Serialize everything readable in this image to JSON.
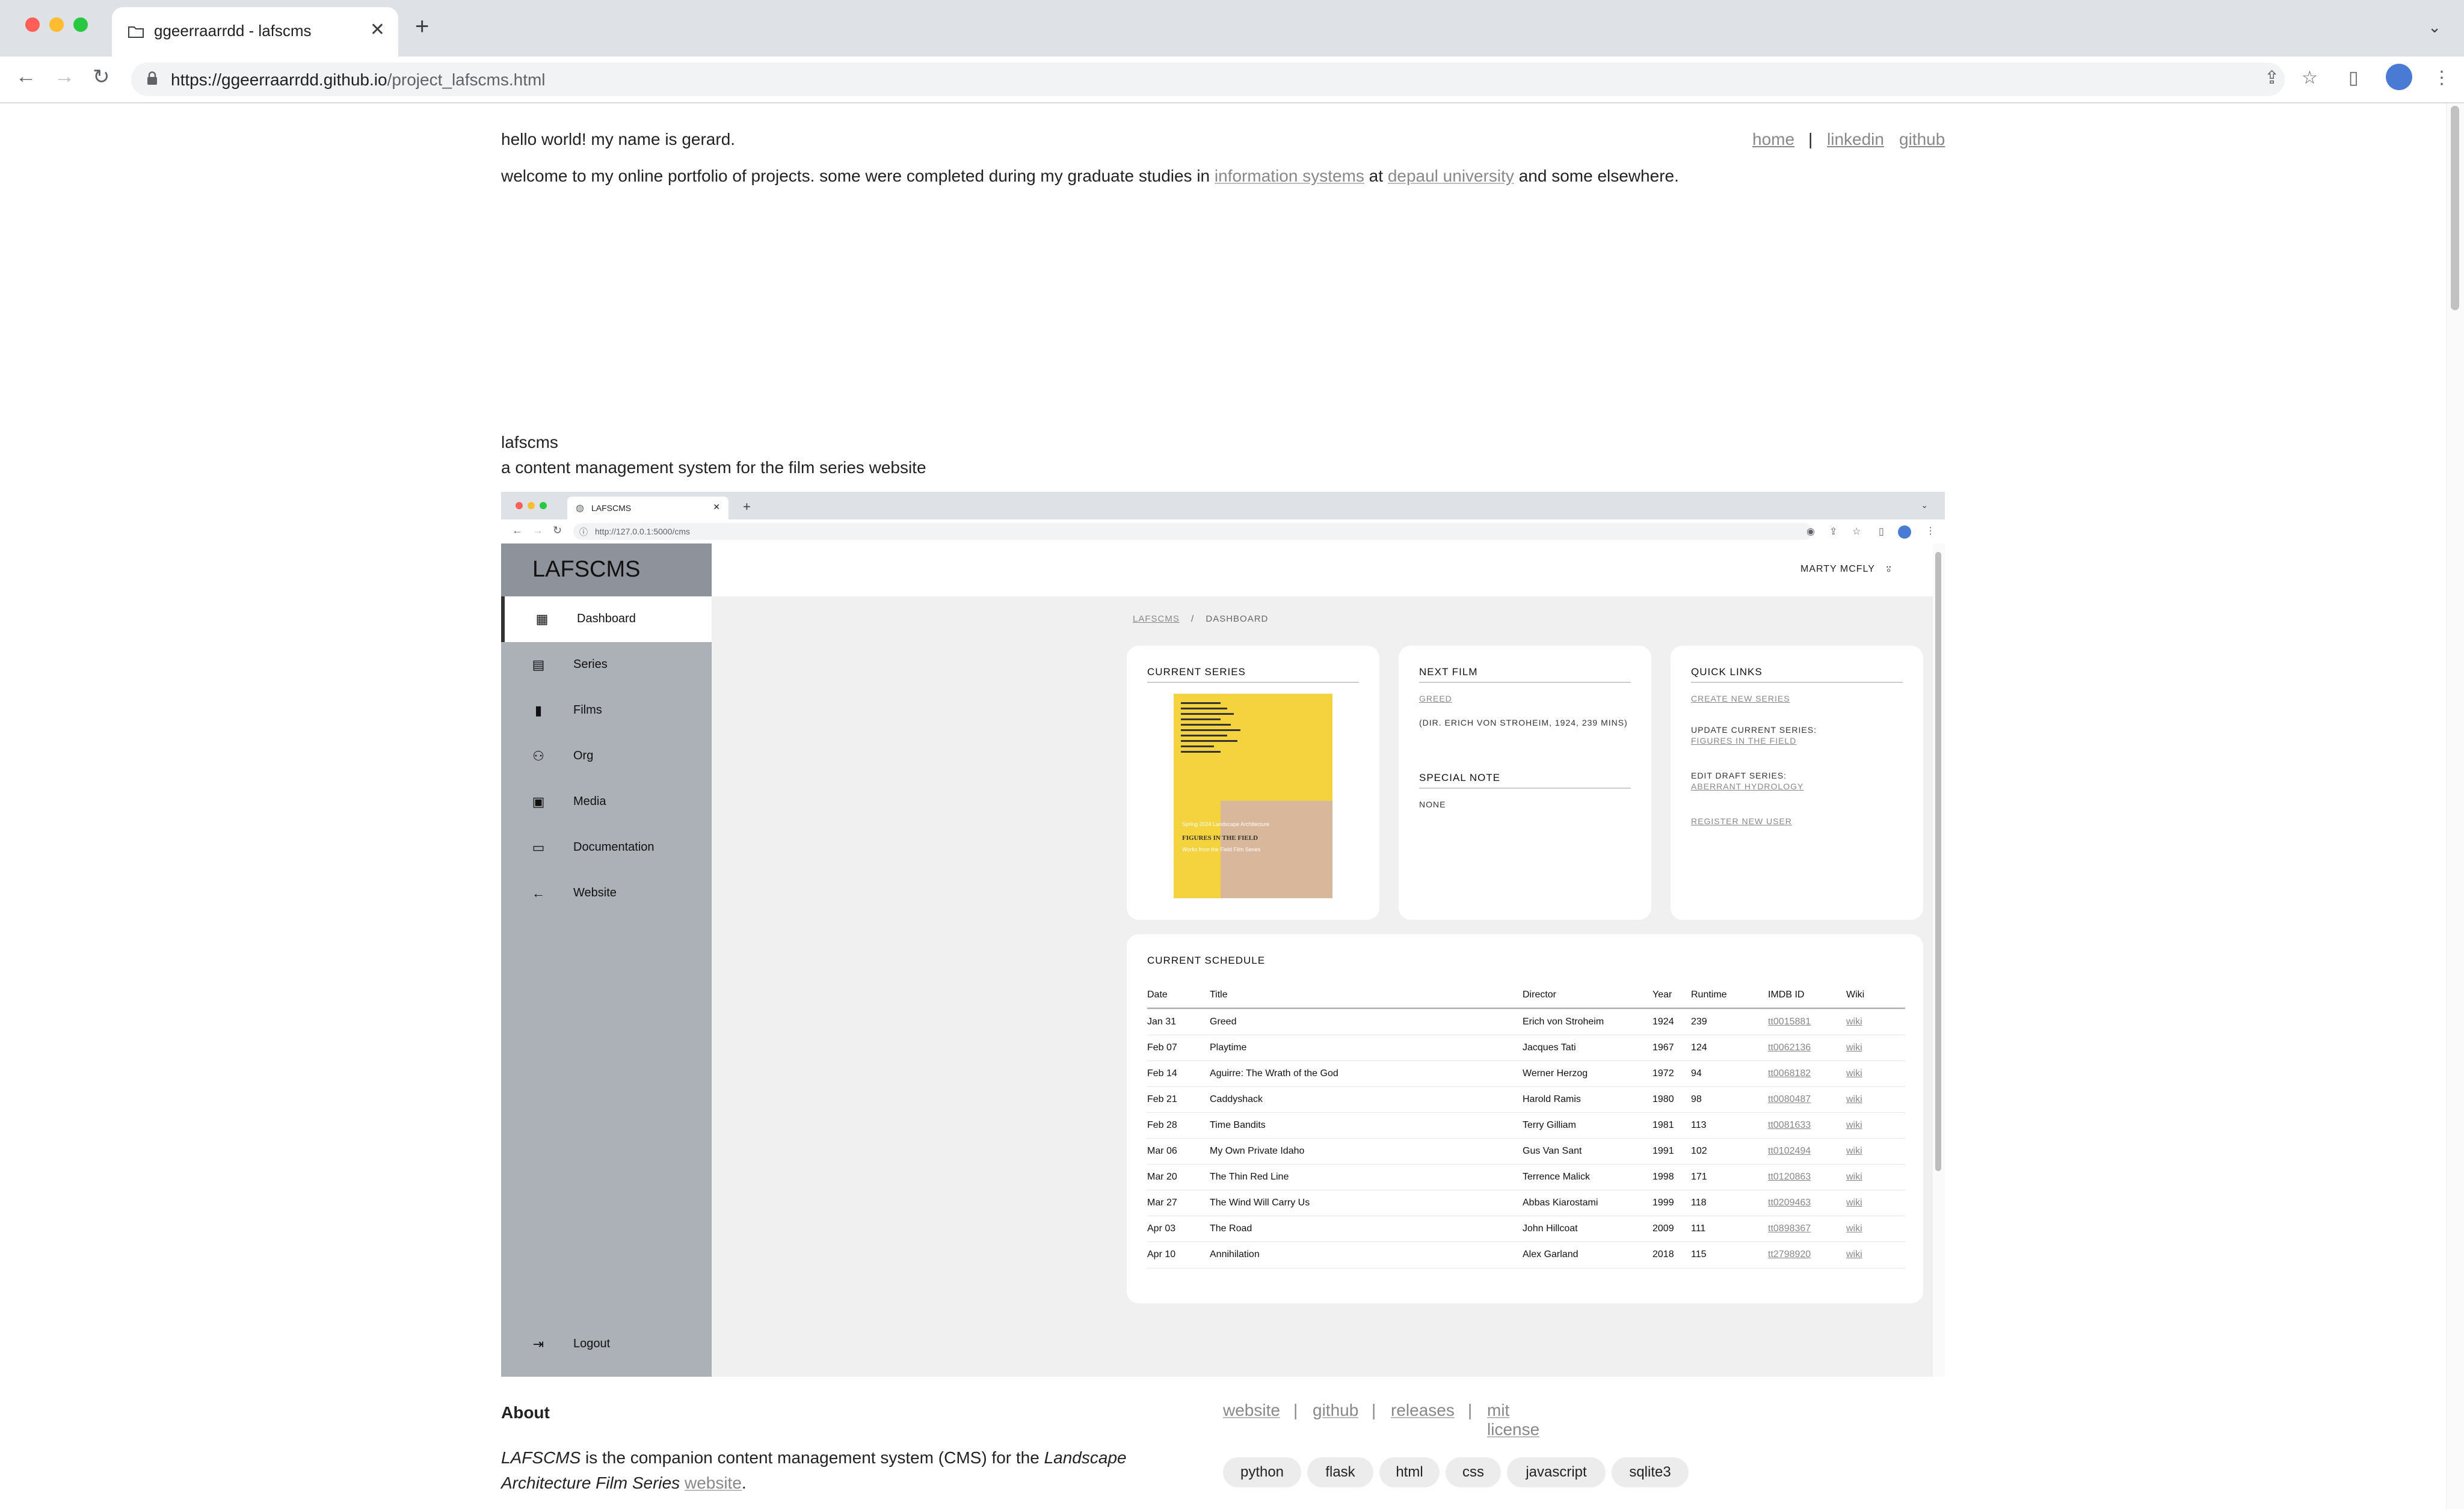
{
  "browser": {
    "tab_title": "ggeerraarrdd - lafscms",
    "url_host": "https://ggeerraarrdd.github.io",
    "url_path": "/project_lafscms.html"
  },
  "page": {
    "hello": "hello world! my name is gerard.",
    "welcome_pre": "welcome to my online portfolio of projects. some were completed during my graduate studies in ",
    "welcome_link1": "information systems",
    "welcome_mid": " at ",
    "welcome_link2": "depaul university",
    "welcome_post": " and some elsewhere.",
    "nav": {
      "home": "home",
      "sep": "|",
      "linkedin": "linkedin",
      "github": "github"
    },
    "project_name": "lafscms",
    "project_desc": "a content management system for the film series website"
  },
  "inner": {
    "tab_title": "LAFSCMS",
    "url": "http://127.0.0.1:5000/cms",
    "brand": "LAFSCMS",
    "user": "MARTY MCFLY",
    "breadcrumb": {
      "root": "LAFSCMS",
      "sep": "/",
      "current": "DASHBOARD"
    },
    "sidebar": [
      {
        "label": "Dashboard",
        "icon": "dashboard-icon"
      },
      {
        "label": "Series",
        "icon": "calendar-icon"
      },
      {
        "label": "Films",
        "icon": "film-icon"
      },
      {
        "label": "Org",
        "icon": "people-icon"
      },
      {
        "label": "Media",
        "icon": "image-icon"
      },
      {
        "label": "Documentation",
        "icon": "document-icon"
      },
      {
        "label": "Website",
        "icon": "arrow-left-icon"
      }
    ],
    "logout": "Logout",
    "current_series": {
      "title": "CURRENT SERIES",
      "poster_lines": [
        "Spring 2024 Landscape Architecture",
        "FIGURES IN THE FIELD",
        "Works from the Field Film Series"
      ]
    },
    "next_film": {
      "title": "NEXT FILM",
      "film": "GREED",
      "detail": "(DIR. ERICH VON STROHEIM, 1924, 239 MINS)"
    },
    "special_note": {
      "title": "SPECIAL NOTE",
      "value": "NONE"
    },
    "quick_links": {
      "title": "QUICK LINKS",
      "create": "CREATE NEW SERIES",
      "update_label": "UPDATE CURRENT SERIES:",
      "update_link": "FIGURES IN THE FIELD",
      "edit_label": "EDIT DRAFT SERIES:",
      "edit_link": "ABERRANT HYDROLOGY",
      "register": "REGISTER NEW USER"
    },
    "schedule": {
      "title": "CURRENT SCHEDULE",
      "headers": [
        "Date",
        "Title",
        "Director",
        "Year",
        "Runtime",
        "IMDB ID",
        "Wiki"
      ],
      "rows": [
        [
          "Jan 31",
          "Greed",
          "Erich von Stroheim",
          "1924",
          "239",
          "tt0015881",
          "wiki"
        ],
        [
          "Feb 07",
          "Playtime",
          "Jacques Tati",
          "1967",
          "124",
          "tt0062136",
          "wiki"
        ],
        [
          "Feb 14",
          "Aguirre: The Wrath of the God",
          "Werner Herzog",
          "1972",
          "94",
          "tt0068182",
          "wiki"
        ],
        [
          "Feb 21",
          "Caddyshack",
          "Harold Ramis",
          "1980",
          "98",
          "tt0080487",
          "wiki"
        ],
        [
          "Feb 28",
          "Time Bandits",
          "Terry Gilliam",
          "1981",
          "113",
          "tt0081633",
          "wiki"
        ],
        [
          "Mar 06",
          "My Own Private Idaho",
          "Gus Van Sant",
          "1991",
          "102",
          "tt0102494",
          "wiki"
        ],
        [
          "Mar 20",
          "The Thin Red Line",
          "Terrence Malick",
          "1998",
          "171",
          "tt0120863",
          "wiki"
        ],
        [
          "Mar 27",
          "The Wind Will Carry Us",
          "Abbas Kiarostami",
          "1999",
          "118",
          "tt0209463",
          "wiki"
        ],
        [
          "Apr 03",
          "The Road",
          "John Hillcoat",
          "2009",
          "111",
          "tt0898367",
          "wiki"
        ],
        [
          "Apr 10",
          "Annihilation",
          "Alex Garland",
          "2018",
          "115",
          "tt2798920",
          "wiki"
        ]
      ]
    }
  },
  "about": {
    "heading": "About",
    "text_em1": "LAFSCMS",
    "text_mid": " is the companion content management system (CMS) for the ",
    "text_em2": "Landscape Architecture Film Series",
    "text_link": "website",
    "links": [
      "website",
      "github",
      "releases",
      "mit license"
    ],
    "sep": "|",
    "tags": [
      "python",
      "flask",
      "html",
      "css",
      "javascript",
      "sqlite3"
    ]
  }
}
